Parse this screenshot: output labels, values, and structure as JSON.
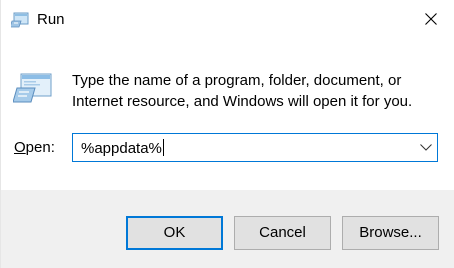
{
  "window": {
    "title": "Run",
    "icon": "run-icon",
    "close_icon": "close-icon"
  },
  "body": {
    "icon": "run-icon",
    "prompt_line1": "Type the name of a program, folder, document, or",
    "prompt_line2": "Internet resource, and Windows will open it for you."
  },
  "open": {
    "label_mnemonic": "O",
    "label_rest": "pen:",
    "value": "%appdata%",
    "dropdown_icon": "chevron-down-icon"
  },
  "buttons": {
    "ok": "OK",
    "cancel": "Cancel",
    "browse": "Browse..."
  },
  "colors": {
    "accent": "#0078d7",
    "footer_bg": "#f0f0f0",
    "button_bg": "#e1e1e1"
  }
}
